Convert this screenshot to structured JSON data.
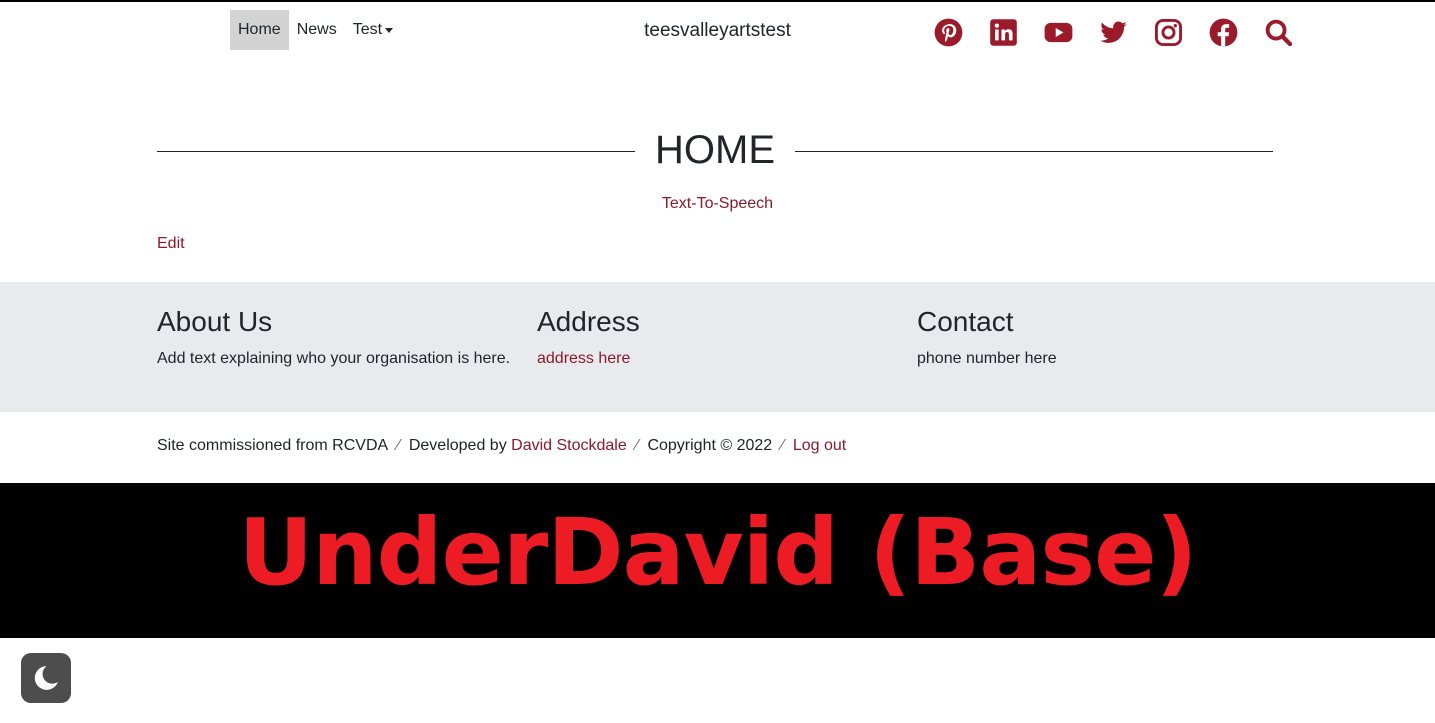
{
  "nav": {
    "links": [
      "Home",
      "News",
      "Test"
    ],
    "brand": "teesvalleyartstest",
    "social_icons": [
      "pinterest-icon",
      "linkedin-icon",
      "youtube-icon",
      "twitter-icon",
      "instagram-icon",
      "facebook-icon",
      "search-icon"
    ]
  },
  "main": {
    "title": "HOME",
    "tts_link": "Text-To-Speech",
    "edit_link": "Edit"
  },
  "footer": {
    "about": {
      "heading": "About Us",
      "text": "Add text explaining who your organisation is here."
    },
    "address": {
      "heading": "Address",
      "text": "address here"
    },
    "contact": {
      "heading": "Contact",
      "text": "phone number here"
    }
  },
  "credits": {
    "commissioned": "Site commissioned from RCVDA",
    "developed_prefix": "Developed by",
    "developer": "David Stockdale",
    "copyright": "Copyright © 2022",
    "logout": "Log out",
    "separator": "⁄"
  },
  "banner": {
    "text": "UnderDavid (Base)"
  },
  "theme": {
    "accent": "#8b1a2b",
    "icon_color": "#9b1b2a",
    "banner_text": "#ed1c24",
    "footer_bg": "#e9eaee"
  },
  "dark_toggle_icon": "moon-icon"
}
